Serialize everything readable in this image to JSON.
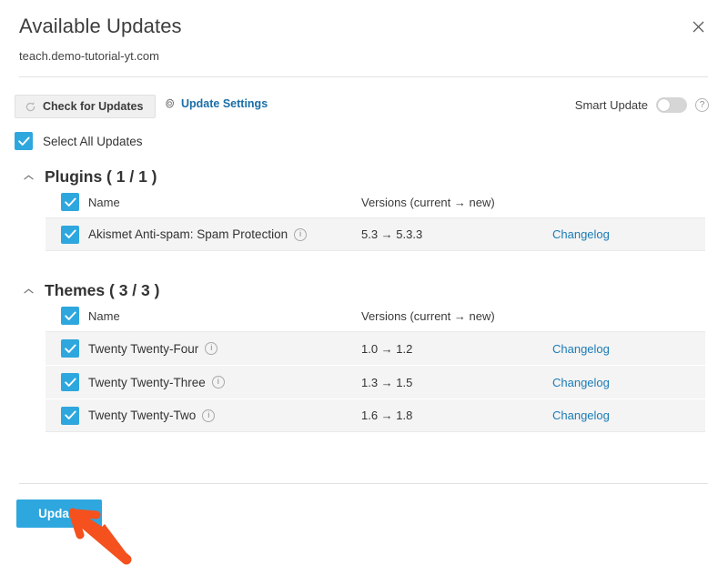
{
  "dialog": {
    "title": "Available Updates",
    "subtitle": "teach.demo-tutorial-yt.com",
    "close_icon": "close-icon"
  },
  "toolbar": {
    "check_updates_label": "Check for Updates",
    "check_updates_icon": "refresh-icon",
    "update_settings_label": "Update Settings",
    "update_settings_icon": "gear-icon",
    "smart_update_label": "Smart Update",
    "smart_update_state": "off",
    "help_icon_glyph": "?"
  },
  "select_all": {
    "label": "Select All Updates",
    "checked": true
  },
  "sections": [
    {
      "key": "plugins",
      "title": "Plugins ( 1 / 1 )",
      "expanded": true,
      "columns": {
        "name": "Name",
        "versions": "Versions (current → new)"
      },
      "header_checked": true,
      "rows": [
        {
          "name": "Akismet Anti-spam: Spam Protection",
          "versions": "5.3 → 5.3.3",
          "changelog": "Changelog",
          "checked": true,
          "info_glyph": "i"
        }
      ]
    },
    {
      "key": "themes",
      "title": "Themes ( 3 / 3 )",
      "expanded": true,
      "columns": {
        "name": "Name",
        "versions": "Versions (current → new)"
      },
      "header_checked": true,
      "rows": [
        {
          "name": "Twenty Twenty-Four",
          "versions": "1.0 → 1.2",
          "changelog": "Changelog",
          "checked": true,
          "info_glyph": "i"
        },
        {
          "name": "Twenty Twenty-Three",
          "versions": "1.3 → 1.5",
          "changelog": "Changelog",
          "checked": true,
          "info_glyph": "i"
        },
        {
          "name": "Twenty Twenty-Two",
          "versions": "1.6 → 1.8",
          "changelog": "Changelog",
          "checked": true,
          "info_glyph": "i"
        }
      ]
    }
  ],
  "footer": {
    "update_label": "Update"
  },
  "annotation": {
    "type": "arrow",
    "color": "#f4511e",
    "points_to": "update-button"
  },
  "colors": {
    "accent_blue": "#2ea7de",
    "link_blue": "#1b7bb5",
    "row_bg": "#f4f4f4",
    "annotation_orange": "#f4511e"
  }
}
